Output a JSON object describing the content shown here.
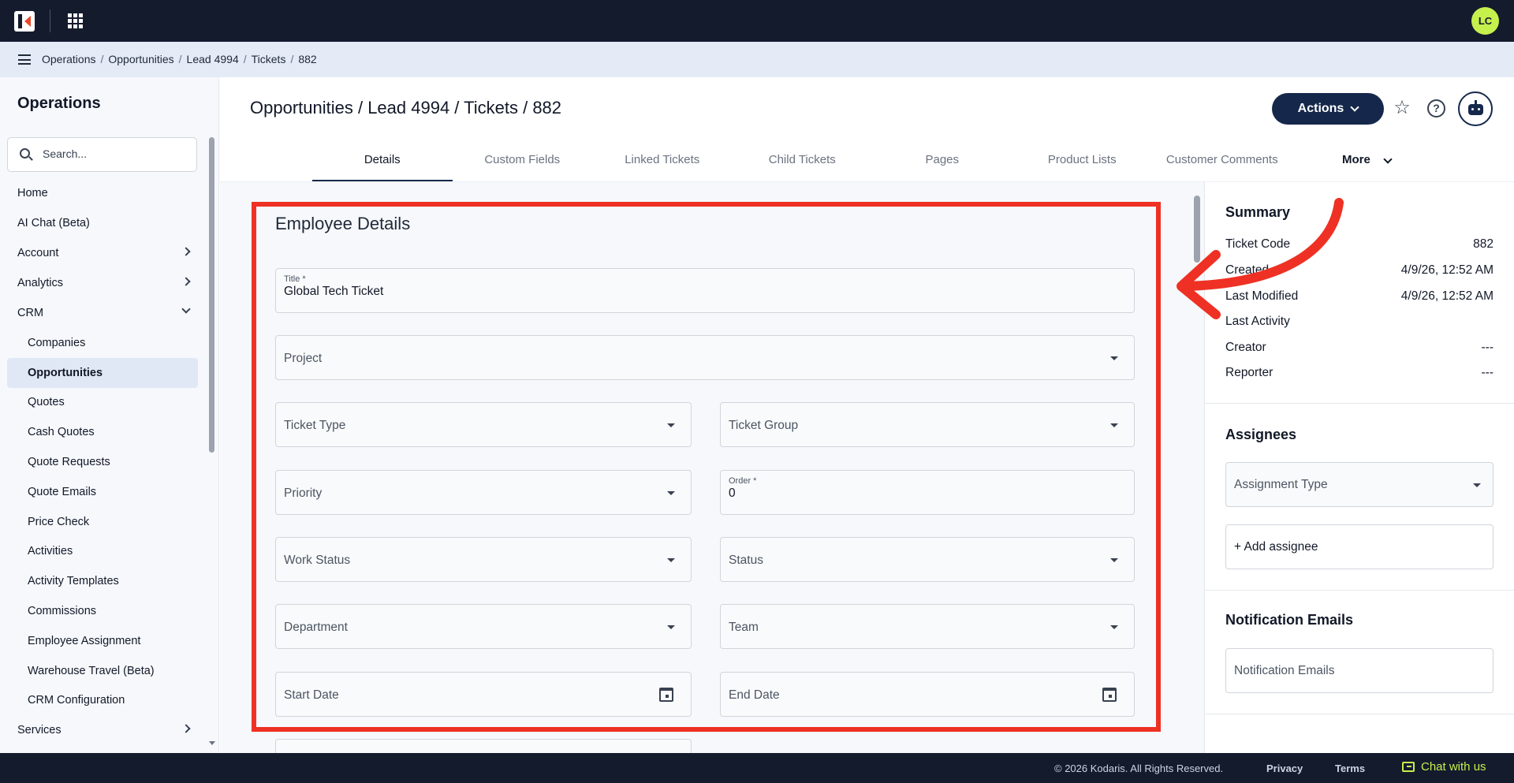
{
  "topbar": {
    "avatar_initials": "LC"
  },
  "breadcrumb": [
    "Operations",
    "Opportunities",
    "Lead 4994",
    "Tickets",
    "882"
  ],
  "sidebar": {
    "title": "Operations",
    "search_placeholder": "Search...",
    "items": [
      {
        "label": "Home"
      },
      {
        "label": "AI Chat (Beta)"
      },
      {
        "label": "Account"
      },
      {
        "label": "Analytics"
      },
      {
        "label": "CRM"
      }
    ],
    "crm_items": [
      {
        "label": "Companies"
      },
      {
        "label": "Opportunities"
      },
      {
        "label": "Quotes"
      },
      {
        "label": "Cash Quotes"
      },
      {
        "label": "Quote Requests"
      },
      {
        "label": "Quote Emails"
      },
      {
        "label": "Price Check"
      },
      {
        "label": "Activities"
      },
      {
        "label": "Activity Templates"
      },
      {
        "label": "Commissions"
      },
      {
        "label": "Employee Assignment"
      },
      {
        "label": "Warehouse Travel (Beta)"
      },
      {
        "label": "CRM Configuration"
      }
    ],
    "after_items": [
      {
        "label": "Services"
      }
    ]
  },
  "header": {
    "title": "Opportunities / Lead 4994 / Tickets / 882",
    "actions_label": "Actions"
  },
  "tabs": [
    "Details",
    "Custom Fields",
    "Linked Tickets",
    "Child Tickets",
    "Pages",
    "Product Lists",
    "Customer Comments"
  ],
  "tab_more_label": "More",
  "form": {
    "section_title": "Employee Details",
    "title_label": "Title *",
    "title_value": "Global Tech Ticket",
    "project": "Project",
    "ticket_type": "Ticket Type",
    "ticket_group": "Ticket Group",
    "priority": "Priority",
    "order_label": "Order *",
    "order_value": "0",
    "work_status": "Work Status",
    "status": "Status",
    "department": "Department",
    "team": "Team",
    "start_date": "Start Date",
    "end_date": "End Date"
  },
  "summary": {
    "heading": "Summary",
    "rows": [
      {
        "label": "Ticket Code",
        "value": "882"
      },
      {
        "label": "Created",
        "value": "4/9/26, 12:52 AM"
      },
      {
        "label": "Last Modified",
        "value": "4/9/26, 12:52 AM"
      },
      {
        "label": "Last Activity",
        "value": ""
      },
      {
        "label": "Creator",
        "value": "---"
      },
      {
        "label": "Reporter",
        "value": "---"
      }
    ]
  },
  "assignees": {
    "heading": "Assignees",
    "assignment_type": "Assignment Type",
    "add_label": "+ Add assignee"
  },
  "notifications": {
    "heading": "Notification Emails",
    "field_label": "Notification Emails"
  },
  "footer": {
    "copyright": "© 2026 Kodaris. All Rights Reserved.",
    "privacy": "Privacy",
    "terms": "Terms",
    "chat": "Chat with us"
  },
  "colors": {
    "topbar": "#141b2d",
    "accent": "#15284b",
    "highlight": "#ee3124",
    "chat": "#c6f04c"
  }
}
